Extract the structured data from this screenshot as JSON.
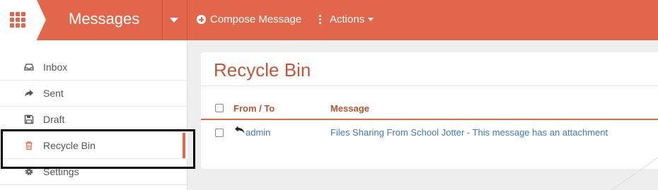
{
  "topbar": {
    "app_title": "Messages",
    "compose_label": "Compose Message",
    "actions_label": "Actions",
    "accent_color": "#e2674a"
  },
  "sidebar": {
    "items": [
      {
        "label": "Inbox",
        "icon": "inbox-icon"
      },
      {
        "label": "Sent",
        "icon": "share-icon"
      },
      {
        "label": "Draft",
        "icon": "floppy-disk-icon"
      },
      {
        "label": "Recycle Bin",
        "icon": "trash-icon",
        "active": true
      },
      {
        "label": "Settings",
        "icon": "gear-icon"
      }
    ]
  },
  "main": {
    "title": "Recycle Bin",
    "table": {
      "columns": [
        "From / To",
        "Message"
      ],
      "rows": [
        {
          "from": "admin",
          "message": "Files Sharing From School Jotter - This message has an attachment"
        }
      ]
    }
  }
}
